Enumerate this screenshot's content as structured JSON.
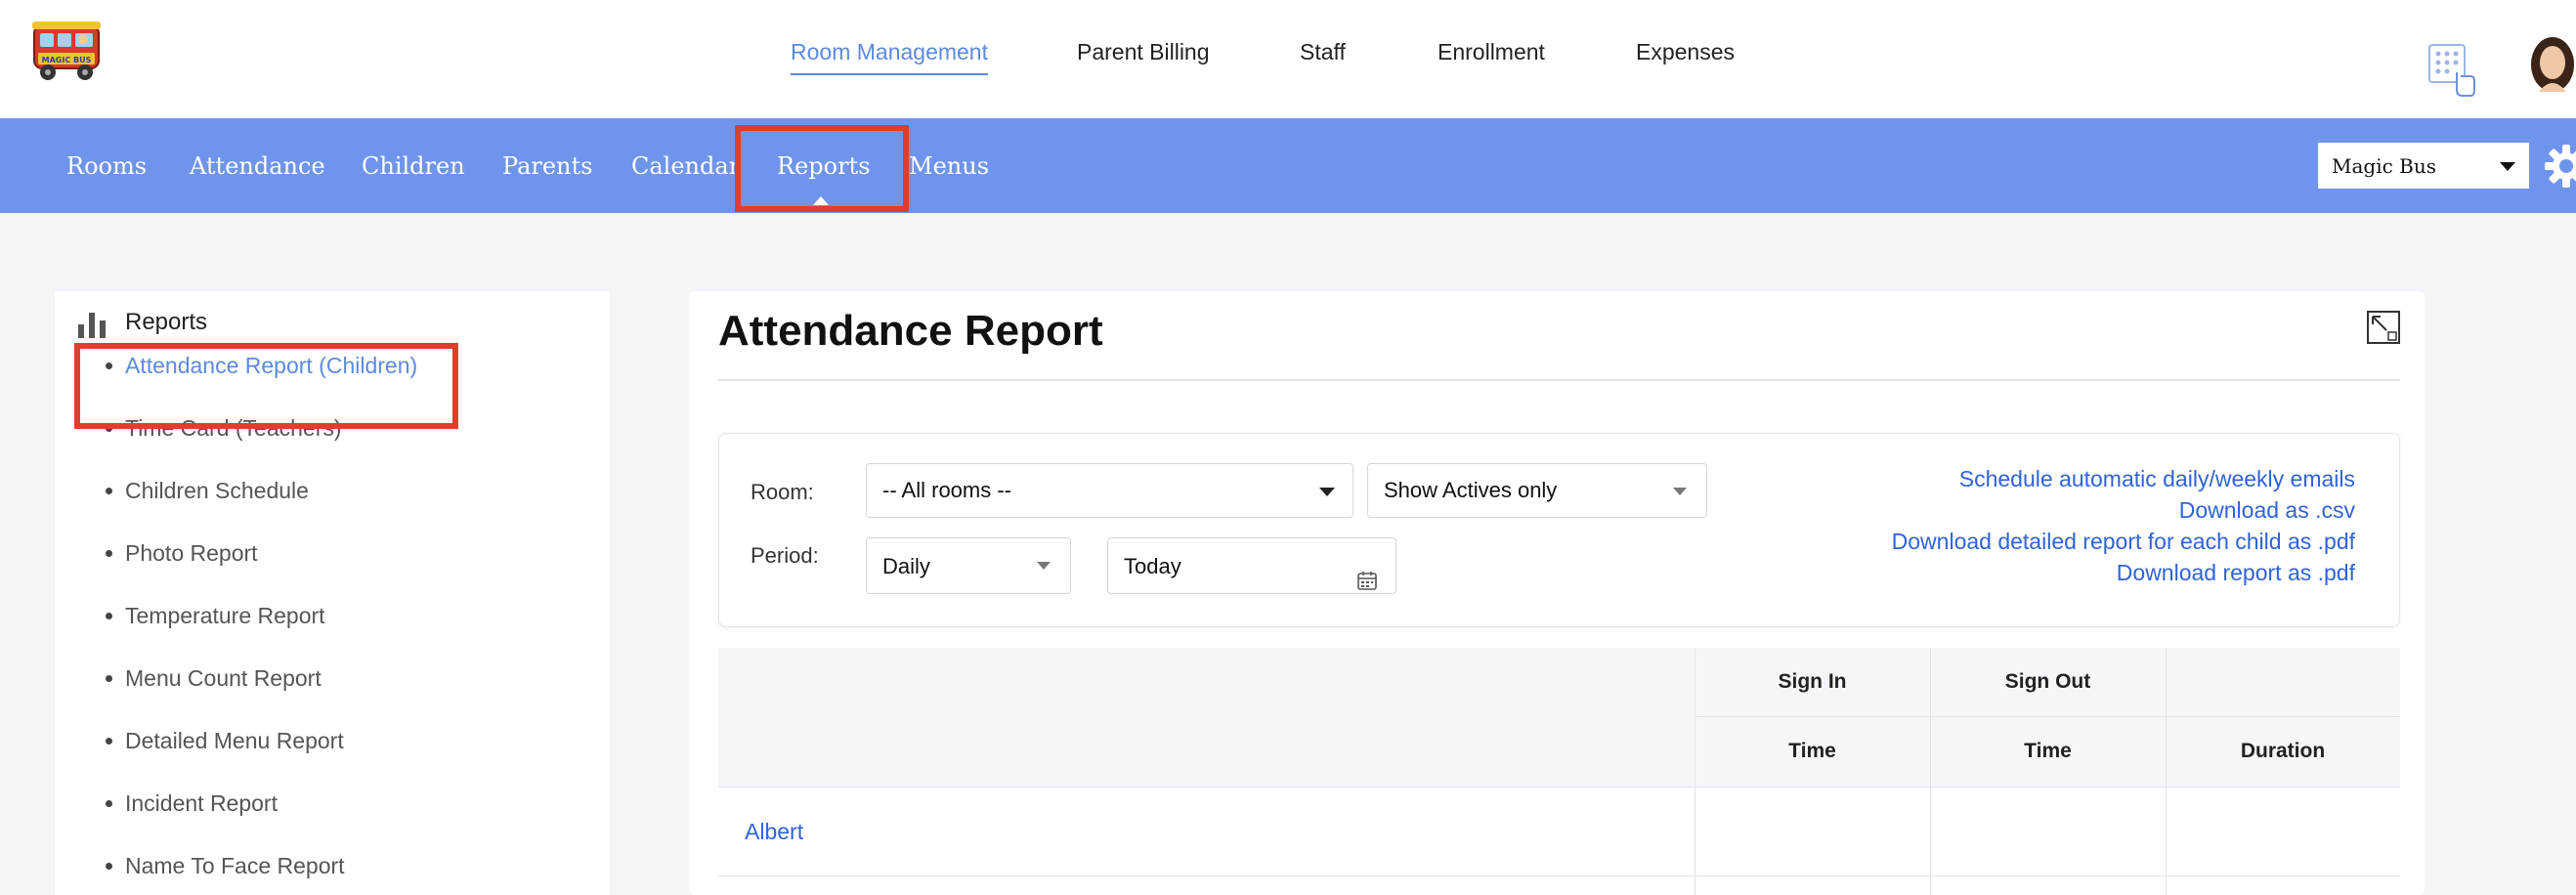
{
  "app": {
    "logo_text": "MAGIC BUS",
    "top_nav": [
      "Room Management",
      "Parent Billing",
      "Staff",
      "Enrollment",
      "Expenses"
    ],
    "top_nav_active": "Room Management",
    "sub_nav": [
      "Rooms",
      "Attendance",
      "Children",
      "Parents",
      "Calendar",
      "Reports",
      "Menus"
    ],
    "sub_nav_active": "Reports",
    "school_select": "Magic Bus"
  },
  "sidebar": {
    "title": "Reports",
    "items": [
      "Attendance Report (Children)",
      "Time Card (Teachers)",
      "Children Schedule",
      "Photo Report",
      "Temperature Report",
      "Menu Count Report",
      "Detailed Menu Report",
      "Incident Report",
      "Name To Face Report"
    ],
    "active_item": "Attendance Report (Children)"
  },
  "main": {
    "title": "Attendance Report",
    "filters": {
      "room_label": "Room:",
      "room_value": "-- All rooms --",
      "status_value": "Show Actives only",
      "period_label": "Period:",
      "period_value": "Daily",
      "date_value": "Today"
    },
    "links": [
      "Schedule automatic daily/weekly emails",
      "Download as .csv",
      "Download detailed report for each child as .pdf",
      "Download report as .pdf"
    ],
    "table": {
      "group_headers": [
        "Sign In",
        "Sign Out"
      ],
      "sub_headers": [
        "Time",
        "Time",
        "Duration"
      ],
      "rows": [
        {
          "name": "Albert"
        }
      ]
    }
  },
  "colors": {
    "accent": "#6f94eb",
    "link": "#2f63d8",
    "highlight": "#e03e2d",
    "active_text": "#5b8ae0"
  },
  "icons": [
    "magic-bus-logo",
    "keypad-icon",
    "user-avatar",
    "gear-icon",
    "bar-chart-icon",
    "expand-icon",
    "calendar-icon",
    "chevron-down-icon"
  ]
}
